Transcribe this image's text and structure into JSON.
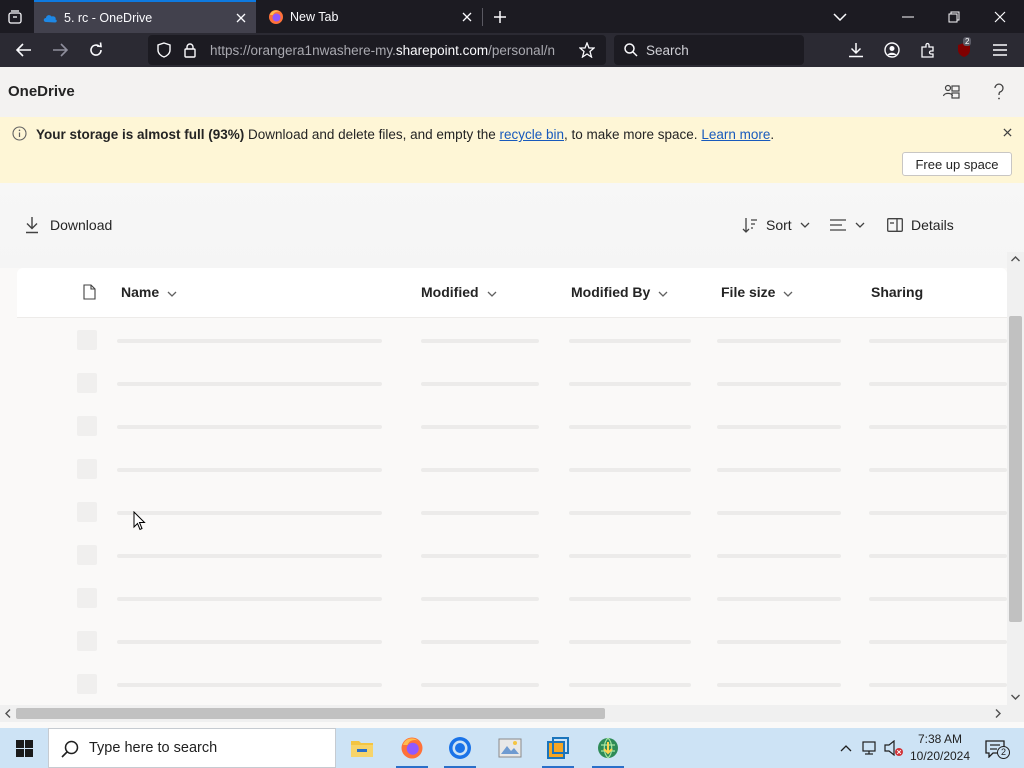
{
  "browser": {
    "tabs": [
      {
        "title": "5. rc - OneDrive",
        "active": true
      },
      {
        "title": "New Tab",
        "active": false
      }
    ],
    "url": {
      "prefix": "https://orangera1nwashere-my.",
      "domain": "sharepoint.com",
      "suffix": "/personal/n"
    },
    "search_placeholder": "Search",
    "extension_badge": "2"
  },
  "onedrive": {
    "app_title": "OneDrive",
    "banner": {
      "strong": "Your storage is almost full (93%)",
      "text1": " Download and delete files, and empty the ",
      "link1": "recycle bin",
      "text2": ", to make more space. ",
      "link2": "Learn more",
      "text3": ".",
      "button": "Free up space"
    },
    "commands": {
      "download": "Download",
      "sort": "Sort",
      "details": "Details"
    },
    "columns": {
      "name": "Name",
      "modified": "Modified",
      "modified_by": "Modified By",
      "file_size": "File size",
      "sharing": "Sharing"
    }
  },
  "taskbar": {
    "search_placeholder": "Type here to search",
    "time": "7:38 AM",
    "date": "10/20/2024",
    "notification_count": "2"
  },
  "colors": {
    "tab_strip": "#1c1b22",
    "active_tab": "#42414d",
    "banner_bg": "#fef6d6",
    "link": "#185abc",
    "taskbar": "#cde3f5"
  }
}
